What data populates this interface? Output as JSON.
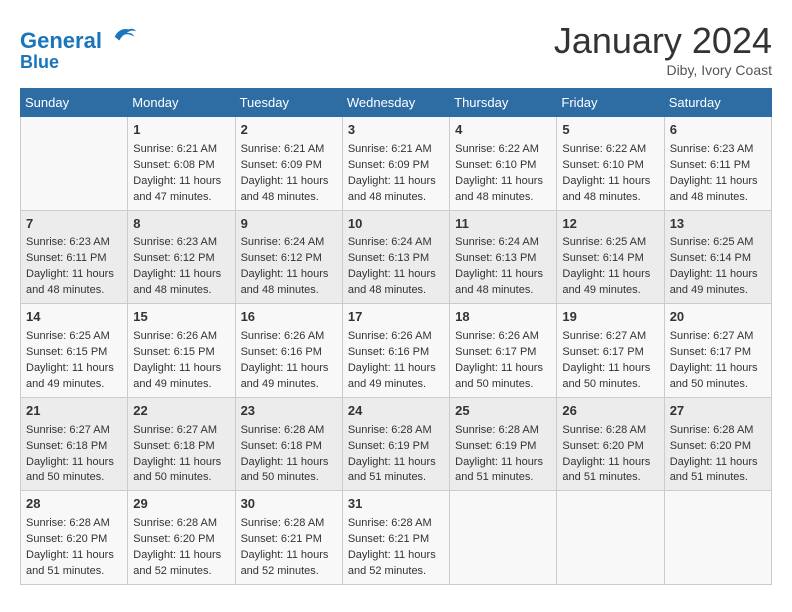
{
  "header": {
    "logo_line1": "General",
    "logo_line2": "Blue",
    "month_title": "January 2024",
    "subtitle": "Diby, Ivory Coast"
  },
  "weekdays": [
    "Sunday",
    "Monday",
    "Tuesday",
    "Wednesday",
    "Thursday",
    "Friday",
    "Saturday"
  ],
  "weeks": [
    [
      {
        "day": "",
        "info": ""
      },
      {
        "day": "1",
        "info": "Sunrise: 6:21 AM\nSunset: 6:08 PM\nDaylight: 11 hours\nand 47 minutes."
      },
      {
        "day": "2",
        "info": "Sunrise: 6:21 AM\nSunset: 6:09 PM\nDaylight: 11 hours\nand 48 minutes."
      },
      {
        "day": "3",
        "info": "Sunrise: 6:21 AM\nSunset: 6:09 PM\nDaylight: 11 hours\nand 48 minutes."
      },
      {
        "day": "4",
        "info": "Sunrise: 6:22 AM\nSunset: 6:10 PM\nDaylight: 11 hours\nand 48 minutes."
      },
      {
        "day": "5",
        "info": "Sunrise: 6:22 AM\nSunset: 6:10 PM\nDaylight: 11 hours\nand 48 minutes."
      },
      {
        "day": "6",
        "info": "Sunrise: 6:23 AM\nSunset: 6:11 PM\nDaylight: 11 hours\nand 48 minutes."
      }
    ],
    [
      {
        "day": "7",
        "info": "Sunrise: 6:23 AM\nSunset: 6:11 PM\nDaylight: 11 hours\nand 48 minutes."
      },
      {
        "day": "8",
        "info": "Sunrise: 6:23 AM\nSunset: 6:12 PM\nDaylight: 11 hours\nand 48 minutes."
      },
      {
        "day": "9",
        "info": "Sunrise: 6:24 AM\nSunset: 6:12 PM\nDaylight: 11 hours\nand 48 minutes."
      },
      {
        "day": "10",
        "info": "Sunrise: 6:24 AM\nSunset: 6:13 PM\nDaylight: 11 hours\nand 48 minutes."
      },
      {
        "day": "11",
        "info": "Sunrise: 6:24 AM\nSunset: 6:13 PM\nDaylight: 11 hours\nand 48 minutes."
      },
      {
        "day": "12",
        "info": "Sunrise: 6:25 AM\nSunset: 6:14 PM\nDaylight: 11 hours\nand 49 minutes."
      },
      {
        "day": "13",
        "info": "Sunrise: 6:25 AM\nSunset: 6:14 PM\nDaylight: 11 hours\nand 49 minutes."
      }
    ],
    [
      {
        "day": "14",
        "info": "Sunrise: 6:25 AM\nSunset: 6:15 PM\nDaylight: 11 hours\nand 49 minutes."
      },
      {
        "day": "15",
        "info": "Sunrise: 6:26 AM\nSunset: 6:15 PM\nDaylight: 11 hours\nand 49 minutes."
      },
      {
        "day": "16",
        "info": "Sunrise: 6:26 AM\nSunset: 6:16 PM\nDaylight: 11 hours\nand 49 minutes."
      },
      {
        "day": "17",
        "info": "Sunrise: 6:26 AM\nSunset: 6:16 PM\nDaylight: 11 hours\nand 49 minutes."
      },
      {
        "day": "18",
        "info": "Sunrise: 6:26 AM\nSunset: 6:17 PM\nDaylight: 11 hours\nand 50 minutes."
      },
      {
        "day": "19",
        "info": "Sunrise: 6:27 AM\nSunset: 6:17 PM\nDaylight: 11 hours\nand 50 minutes."
      },
      {
        "day": "20",
        "info": "Sunrise: 6:27 AM\nSunset: 6:17 PM\nDaylight: 11 hours\nand 50 minutes."
      }
    ],
    [
      {
        "day": "21",
        "info": "Sunrise: 6:27 AM\nSunset: 6:18 PM\nDaylight: 11 hours\nand 50 minutes."
      },
      {
        "day": "22",
        "info": "Sunrise: 6:27 AM\nSunset: 6:18 PM\nDaylight: 11 hours\nand 50 minutes."
      },
      {
        "day": "23",
        "info": "Sunrise: 6:28 AM\nSunset: 6:18 PM\nDaylight: 11 hours\nand 50 minutes."
      },
      {
        "day": "24",
        "info": "Sunrise: 6:28 AM\nSunset: 6:19 PM\nDaylight: 11 hours\nand 51 minutes."
      },
      {
        "day": "25",
        "info": "Sunrise: 6:28 AM\nSunset: 6:19 PM\nDaylight: 11 hours\nand 51 minutes."
      },
      {
        "day": "26",
        "info": "Sunrise: 6:28 AM\nSunset: 6:20 PM\nDaylight: 11 hours\nand 51 minutes."
      },
      {
        "day": "27",
        "info": "Sunrise: 6:28 AM\nSunset: 6:20 PM\nDaylight: 11 hours\nand 51 minutes."
      }
    ],
    [
      {
        "day": "28",
        "info": "Sunrise: 6:28 AM\nSunset: 6:20 PM\nDaylight: 11 hours\nand 51 minutes."
      },
      {
        "day": "29",
        "info": "Sunrise: 6:28 AM\nSunset: 6:20 PM\nDaylight: 11 hours\nand 52 minutes."
      },
      {
        "day": "30",
        "info": "Sunrise: 6:28 AM\nSunset: 6:21 PM\nDaylight: 11 hours\nand 52 minutes."
      },
      {
        "day": "31",
        "info": "Sunrise: 6:28 AM\nSunset: 6:21 PM\nDaylight: 11 hours\nand 52 minutes."
      },
      {
        "day": "",
        "info": ""
      },
      {
        "day": "",
        "info": ""
      },
      {
        "day": "",
        "info": ""
      }
    ]
  ]
}
